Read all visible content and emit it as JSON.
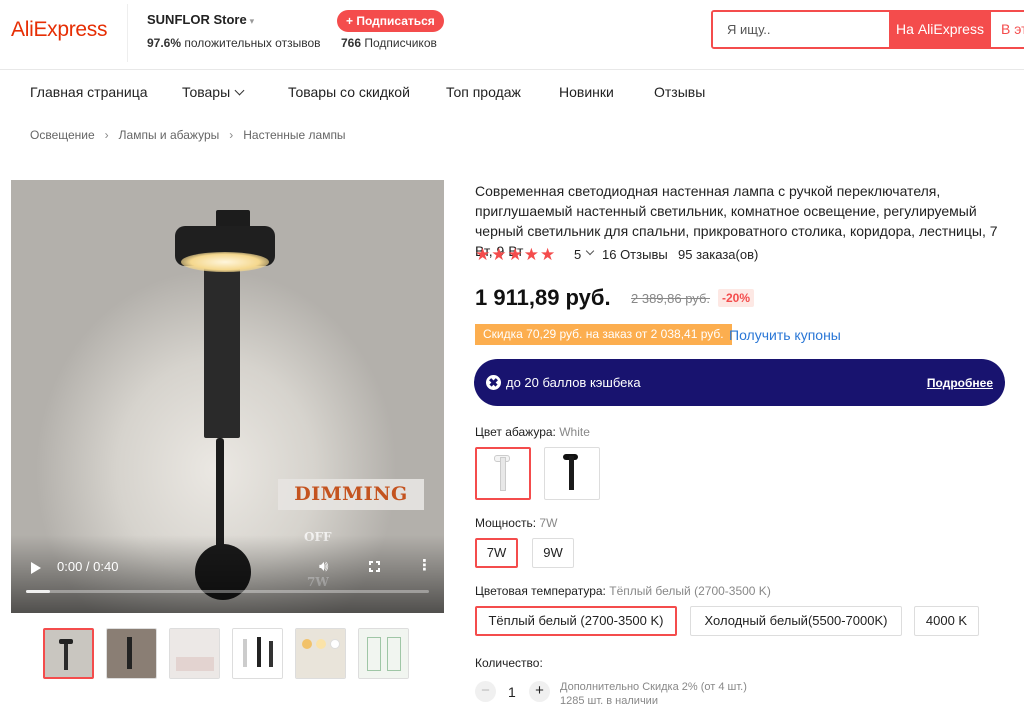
{
  "header": {
    "logo": "AliExpress",
    "store_name": "SUNFLOR Store",
    "store_caret": "▾",
    "feedback_pct": "97.6%",
    "feedback_label": "положительных отзывов",
    "subscribe_label": "+ Подписаться",
    "subscribers_count": "766",
    "subscribers_label": "Подписчиков",
    "search_placeholder": "Я ищу..",
    "search_aliexpress": "На AliExpress",
    "search_store": "В эт"
  },
  "nav": {
    "items": [
      "Главная страница",
      "Товары",
      "Товары со скидкой",
      "Топ продаж",
      "Новинки",
      "Отзывы"
    ]
  },
  "breadcrumb": [
    "Освещение",
    "Лампы и абажуры",
    "Настенные лампы"
  ],
  "video": {
    "overlay_title": "DIMMING",
    "overlay_off": "OFF",
    "overlay_7w": "7W",
    "time": "0:00 / 0:40",
    "progress": 0.06
  },
  "thumbnails": [
    "thumb-1",
    "thumb-2",
    "thumb-3",
    "thumb-4",
    "thumb-5",
    "thumb-6"
  ],
  "product": {
    "title": "Современная светодиодная настенная лампа с ручкой переключателя, приглушаемый настенный светильник, комнатное освещение, регулируемый черный светильник для спальни, прикроватного столика, коридора, лестницы, 7 Вт, 9 Вт",
    "stars": "★★★★★",
    "rating": "5",
    "reviews": "16 Отзывы",
    "orders": "95 заказа(ов)",
    "price": "1 911,89 руб.",
    "old_price": "2 389,86 руб.",
    "discount": "-20%",
    "coupon": "Скидка 70,29 руб. на заказ от 2 038,41 руб.",
    "get_coupons": "Получить купоны",
    "cashback": "до 20 баллов кэшбека",
    "cashback_more": "Подробнее"
  },
  "options": {
    "shade_color_label": "Цвет абажура:",
    "shade_color_value": "White",
    "power_label": "Мощность:",
    "power_value": "7W",
    "power_options": [
      "7W",
      "9W"
    ],
    "temp_label": "Цветовая температура:",
    "temp_value": "Тёплый белый (2700-3500 K)",
    "temp_options": [
      "Тёплый белый (2700-3500 K)",
      "Холодный белый(5500-7000K)",
      "4000 K"
    ]
  },
  "quantity": {
    "label": "Количество:",
    "minus": "−",
    "value": "1",
    "plus": "+",
    "note_line1": "Дополнительно Скидка 2% (от 4 шт.)",
    "note_line2": "1285 шт. в наличии"
  },
  "colors": {
    "accent": "#f44c4c",
    "logo": "#e62e04",
    "cashback_bg": "#18136f",
    "coupon_bg": "#fcae4f",
    "link": "#2a77d6"
  }
}
